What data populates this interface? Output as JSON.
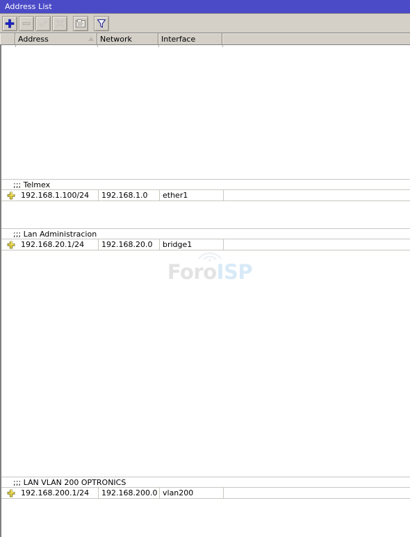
{
  "window": {
    "title": "Address List"
  },
  "toolbar": {
    "buttons": [
      {
        "name": "add-button",
        "icon": "plus-icon",
        "enabled": true,
        "tooltip": "Add"
      },
      {
        "name": "remove-button",
        "icon": "minus-icon",
        "enabled": false,
        "tooltip": "Remove"
      },
      {
        "name": "enable-button",
        "icon": "check-icon",
        "enabled": false,
        "tooltip": "Enable"
      },
      {
        "name": "disable-button",
        "icon": "cross-icon",
        "enabled": false,
        "tooltip": "Disable"
      },
      {
        "name": "comment-button",
        "icon": "comment-icon",
        "enabled": true,
        "tooltip": "Comment"
      },
      {
        "name": "filter-button",
        "icon": "funnel-icon",
        "enabled": true,
        "tooltip": "Filter"
      }
    ]
  },
  "table": {
    "columns": [
      {
        "key": "marker",
        "label": "",
        "sorted": false
      },
      {
        "key": "address",
        "label": "Address",
        "sorted": true
      },
      {
        "key": "network",
        "label": "Network",
        "sorted": false
      },
      {
        "key": "interface",
        "label": "Interface",
        "sorted": false
      },
      {
        "key": "filler",
        "label": "",
        "sorted": false
      }
    ],
    "groups": [
      {
        "comment": ";;; Telmex",
        "rows": [
          {
            "flag": "dynamic-flag-icon",
            "address": "192.168.1.100/24",
            "network": "192.168.1.0",
            "interface": "ether1"
          }
        ]
      },
      {
        "comment": ";;; Lan Administracion",
        "rows": [
          {
            "flag": "dynamic-flag-icon",
            "address": "192.168.20.1/24",
            "network": "192.168.20.0",
            "interface": "bridge1"
          }
        ]
      },
      {
        "comment": ";;; LAN VLAN 200 OPTRONICS",
        "rows": [
          {
            "flag": "dynamic-flag-icon",
            "address": "192.168.200.1/24",
            "network": "192.168.200.0",
            "interface": "vlan200"
          }
        ]
      }
    ]
  },
  "watermark": {
    "part1": "Foro",
    "part2": "ISP"
  },
  "colors": {
    "titlebar": "#4b4bc8",
    "chrome": "#d4d0c8",
    "accent_add": "#1a23c8",
    "flag_yellow": "#e8d54a",
    "watermark_gray": "#e3e3e3",
    "watermark_blue": "#d8eaf7"
  }
}
